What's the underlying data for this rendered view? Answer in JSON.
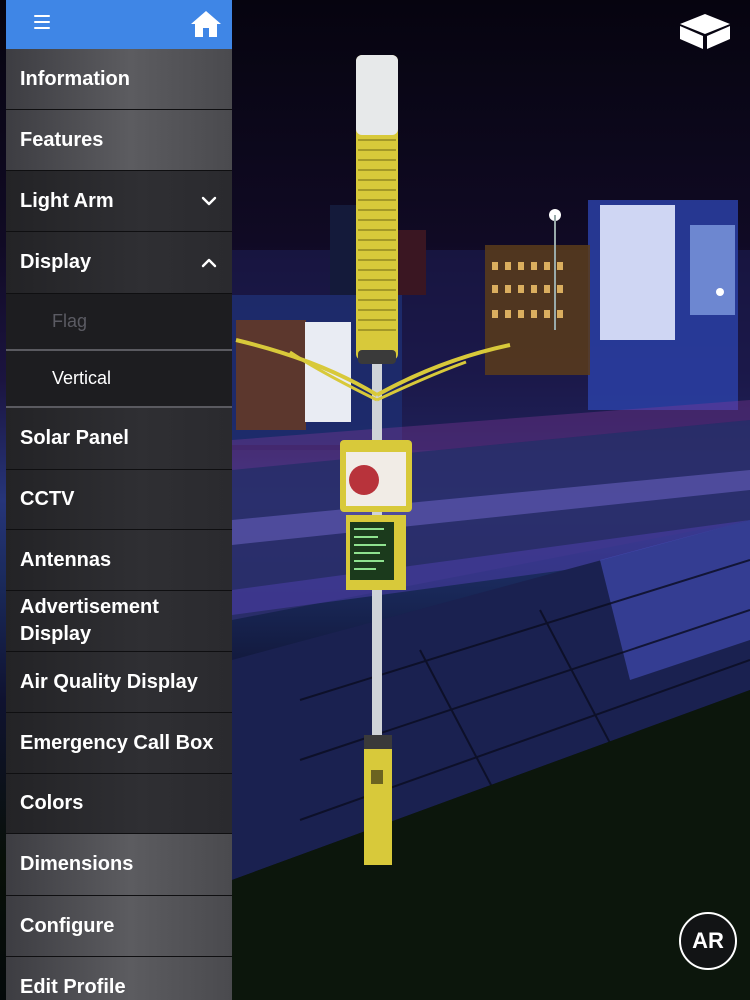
{
  "menu": {
    "items": [
      {
        "label": "Information"
      },
      {
        "label": "Features"
      },
      {
        "label": "Light Arm"
      },
      {
        "label": "Display"
      },
      {
        "label": "Flag"
      },
      {
        "label": "Vertical"
      },
      {
        "label": "Solar Panel"
      },
      {
        "label": "CCTV"
      },
      {
        "label": "Antennas"
      },
      {
        "label": "Advertisement Display"
      },
      {
        "label": "Air Quality Display"
      },
      {
        "label": "Emergency Call Box"
      },
      {
        "label": "Colors"
      },
      {
        "label": "Dimensions"
      },
      {
        "label": "Configure"
      },
      {
        "label": "Edit Profile"
      }
    ]
  },
  "buttons": {
    "ar_label": "AR"
  },
  "icons": {
    "menu": "hamburger-icon",
    "home": "home-icon",
    "view": "cube-icon",
    "expand": "chevron-down-icon",
    "collapse": "chevron-up-icon"
  },
  "colors": {
    "topbar": "#3f86e6",
    "pole_accent": "#d8c93a"
  }
}
